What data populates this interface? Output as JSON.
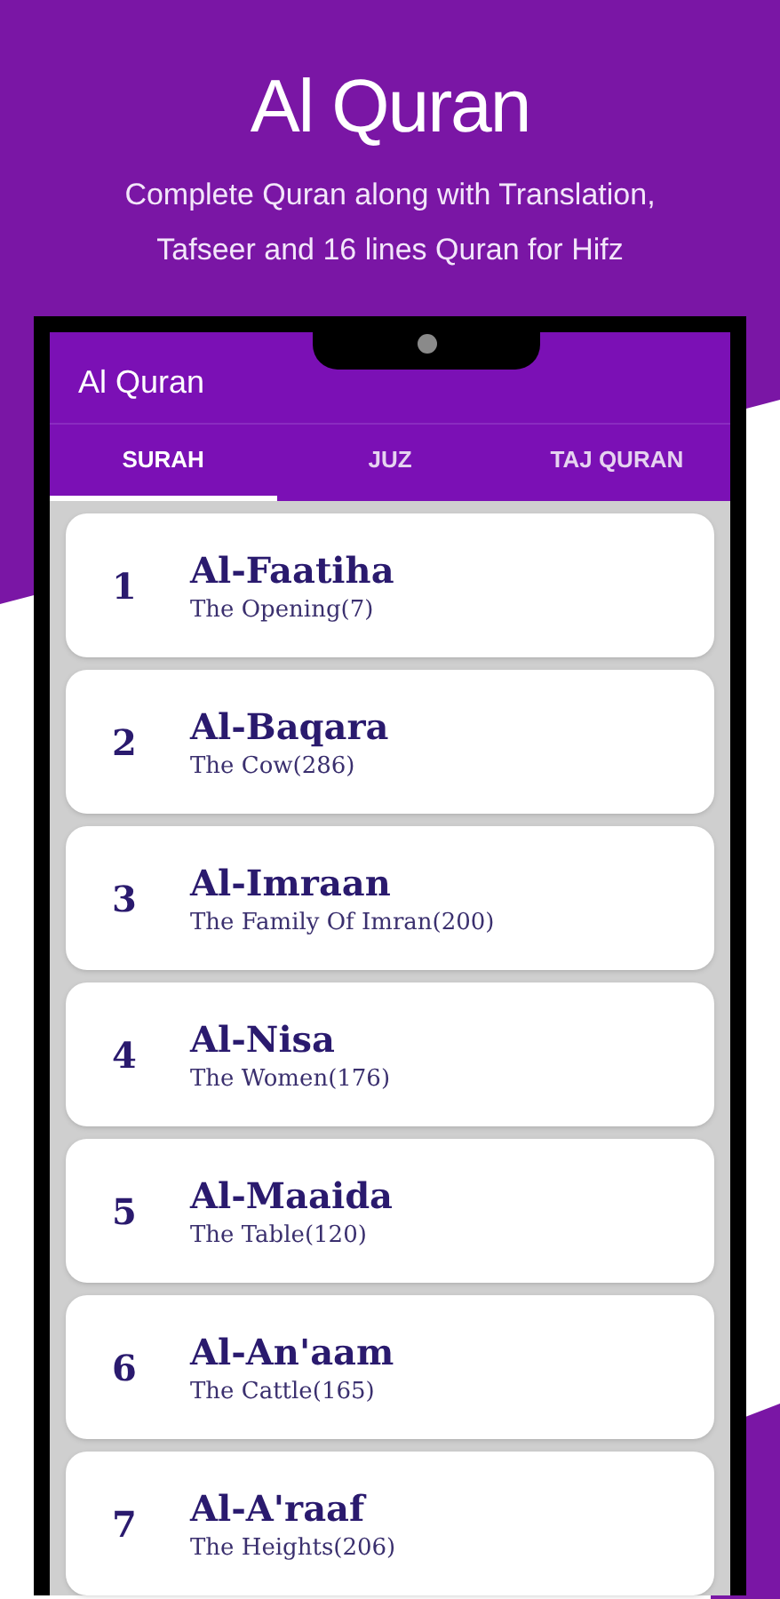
{
  "promo": {
    "title": "Al Quran",
    "subtitle": "Complete Quran along with Translation, Tafseer and 16 lines Quran for Hifz"
  },
  "app_bar": {
    "title": "Al Quran"
  },
  "tabs": [
    {
      "label": "SURAH",
      "selected": true
    },
    {
      "label": "JUZ",
      "selected": false
    },
    {
      "label": "TAJ QURAN",
      "selected": false
    }
  ],
  "surahs": [
    {
      "number": "1",
      "name": "Al-Faatiha",
      "meaning": "The Opening(7)"
    },
    {
      "number": "2",
      "name": "Al-Baqara",
      "meaning": "The Cow(286)"
    },
    {
      "number": "3",
      "name": "Al-Imraan",
      "meaning": "The Family Of Imran(200)"
    },
    {
      "number": "4",
      "name": "Al-Nisa",
      "meaning": "The Women(176)"
    },
    {
      "number": "5",
      "name": "Al-Maaida",
      "meaning": "The Table(120)"
    },
    {
      "number": "6",
      "name": "Al-An'aam",
      "meaning": "The Cattle(165)"
    },
    {
      "number": "7",
      "name": "Al-A'raaf",
      "meaning": "The Heights(206)"
    }
  ]
}
